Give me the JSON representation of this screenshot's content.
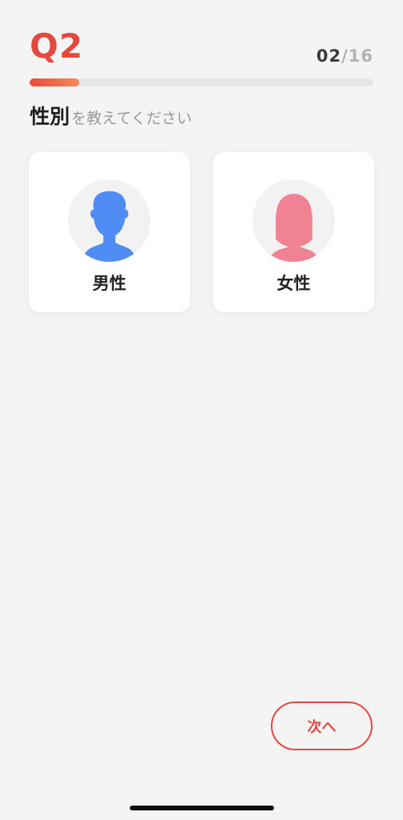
{
  "header": {
    "question_number": "Q2",
    "counter_current": "02",
    "counter_separator": "/",
    "counter_total": "16"
  },
  "progress": {
    "fraction": 0.145,
    "start_color": "#e9493b",
    "end_color": "#f48a5a"
  },
  "question": {
    "main": "性別",
    "sub": "を教えてください"
  },
  "options": [
    {
      "label": "男性",
      "icon": "male-avatar-icon",
      "color": "#4f8df5"
    },
    {
      "label": "女性",
      "icon": "female-avatar-icon",
      "color": "#ef8393"
    }
  ],
  "footer": {
    "next_label": "次へ",
    "accent_color": "#e5483c"
  }
}
